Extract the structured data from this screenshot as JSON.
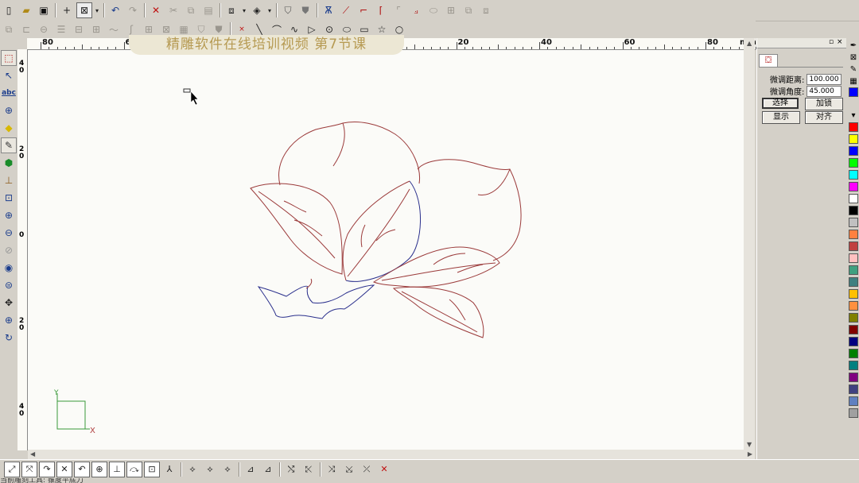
{
  "banner": {
    "title": "精雕软件在线培训视频   第7节课"
  },
  "toolbar_top": {
    "groups": [
      [
        "new-file-icon",
        "open-folder-icon",
        "save-icon"
      ],
      [
        "add-point-icon",
        "box-select-icon",
        "dropdown-arrow-icon"
      ],
      [
        "undo-icon",
        "redo-icon"
      ],
      [
        "delete-icon",
        "cut-icon",
        "copy-icon",
        "paste-icon"
      ],
      [
        "group-icon",
        "dropdown-arrow-icon",
        "ungroup-icon",
        "dropdown-arrow-icon"
      ],
      [
        "shield-outline-icon",
        "shield-filled-icon"
      ],
      [
        "node-edit-icon",
        "trim-icon",
        "corner-icon",
        "chamfer-icon",
        "fillet-icon",
        "extend-icon",
        "offset-icon",
        "array-icon",
        "mirror-icon",
        "align-icon"
      ]
    ]
  },
  "toolbar_draw": {
    "dim_icons": [
      "copy-group-icon",
      "align-left-icon",
      "align-center-icon",
      "distribute-icon",
      "shape-a-icon",
      "shape-b-icon",
      "wave-icon",
      "curve-icon",
      "grid-icon",
      "node-icon",
      "fill-icon",
      "shield-grey-icon",
      "shield-grey-2-icon"
    ],
    "draw_icons": [
      "point-icon",
      "line-icon",
      "arc-icon",
      "spline-icon",
      "polyline-icon",
      "circle-small-icon",
      "ellipse-icon",
      "rectangle-icon",
      "star-icon",
      "circle-icon"
    ]
  },
  "ruler": {
    "unit": "mm",
    "labels": [
      "80",
      "60",
      "40",
      "20",
      "0",
      "20",
      "40",
      "60",
      "80"
    ],
    "v_labels": [
      "4\n0",
      "2\n0",
      "0",
      "2\n0",
      "4\n0"
    ]
  },
  "left_tools": [
    "select-rect-icon",
    "node-select-icon",
    "text-abc-icon",
    "circle-target-icon",
    "diamond-icon",
    "eraser-icon",
    "fill-bucket-icon",
    "measure-icon",
    "zoom-box-icon",
    "zoom-in-icon",
    "zoom-out-icon",
    "zoom-prev-icon",
    "eye-icon",
    "zoom-fit-icon",
    "pan-icon",
    "zoom-all-icon",
    "refresh-icon"
  ],
  "right_panel": {
    "tab_icon": "nudge-icon",
    "fields": [
      {
        "label": "微调距离:",
        "value": "100.000"
      },
      {
        "label": "微调角度:",
        "value": "45.000"
      }
    ],
    "buttons": [
      {
        "label": "选择",
        "selected": true
      },
      {
        "label": "加锁",
        "selected": false
      },
      {
        "label": "显示",
        "selected": false
      },
      {
        "label": "对齐",
        "selected": false
      }
    ]
  },
  "palette": {
    "icons": [
      "pen-icon",
      "no-fill-icon",
      "brush-icon",
      "pattern-icon"
    ],
    "colors": [
      "#ff0000",
      "#ffff00",
      "#0000ff",
      "#00ff00",
      "#00ffff",
      "#ff00ff",
      "#ffffff",
      "#000000",
      "#c0c0c0",
      "#ff8040",
      "#c04040",
      "#ffc0c0",
      "#40a080",
      "#408080",
      "#ffc000",
      "#ff9040",
      "#808000",
      "#800000",
      "#000080",
      "#008000",
      "#008080",
      "#800080",
      "#404080",
      "#6080c0",
      "#a0a0a0"
    ]
  },
  "canvas": {
    "axis_x": "X",
    "axis_y": "Y",
    "stroke_red": "#9b3a3a",
    "stroke_blue": "#2a2f8c"
  },
  "bottom_tools": [
    "snap-line-icon",
    "snap-intersect-icon",
    "snap-arc-icon",
    "snap-cross-icon",
    "snap-arc2-icon",
    "snap-circle-icon",
    "snap-perp-icon",
    "snap-tangent-icon",
    "snap-center-icon",
    "snap-angle-icon",
    "snap-diamond1-icon",
    "snap-diamond2-icon",
    "snap-diamond3-icon",
    "snap-flat1-icon",
    "snap-flat2-icon",
    "snap-pick1-icon",
    "snap-pick2-icon",
    "snap-node1-icon",
    "snap-node2-icon",
    "snap-node3-icon",
    "snap-off-icon"
  ],
  "status": {
    "text": "当前雕刻工具: 锥度平底刀"
  }
}
